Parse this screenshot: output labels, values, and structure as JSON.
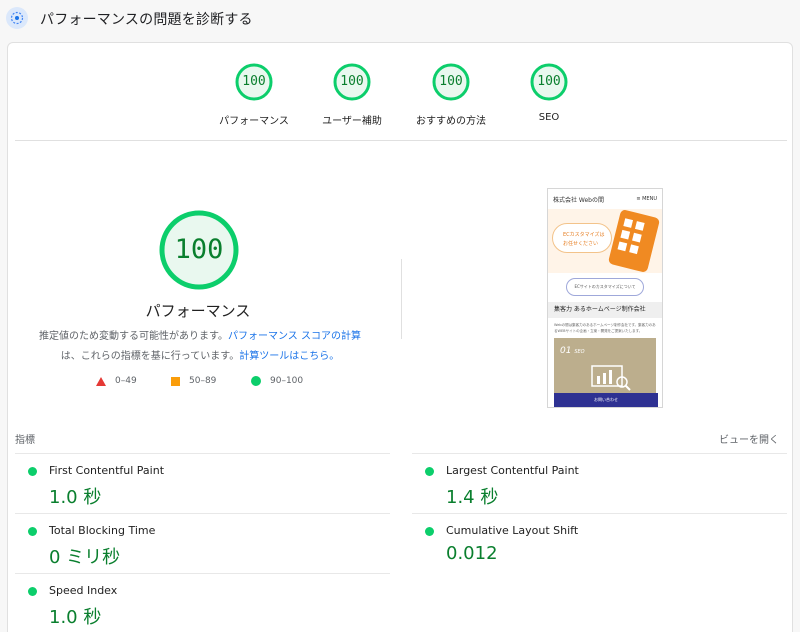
{
  "header": {
    "title": "パフォーマンスの問題を診断する",
    "icon": "lighthouse-icon"
  },
  "colors": {
    "good": "#0cce6b",
    "good_text": "#0a7f2e",
    "average": "#fa9d0a",
    "poor": "#e53935",
    "link": "#1a73e8"
  },
  "gauges": [
    {
      "score": "100",
      "label": "パフォーマンス",
      "fraction": 1.0
    },
    {
      "score": "100",
      "label": "ユーザー補助",
      "fraction": 1.0
    },
    {
      "score": "100",
      "label": "おすすめの方法",
      "fraction": 1.0
    },
    {
      "score": "100",
      "label": "SEO",
      "fraction": 1.0
    }
  ],
  "performance": {
    "score": "100",
    "label": "パフォーマンス",
    "desc_part1": "推定値のため変動する可能性があります。",
    "desc_link1": "パフォーマンス スコアの計算",
    "desc_part2": "は、これらの指標を基に行っています。",
    "desc_link2": "計算ツールはこちら。"
  },
  "legend": {
    "poor": "0–49",
    "average": "50–89",
    "good": "90–100"
  },
  "preview": {
    "brand": "株式会社 Webの間",
    "menu": "≡ MENU",
    "hero_line1": "ECカスタマイズは",
    "hero_line2": "お任せください",
    "button": "ECサイトのカスタマイズについて",
    "section_title": "集客力 あるホームページ制作会社",
    "body_text": "Webの間は集客力のあるホームページ制作会社です。集客力のあるWEBサイトの企画・立案・開発をご提案いたします。",
    "image_label": "01",
    "image_sub": "SEO",
    "footer": "お問い合わせ"
  },
  "metrics": {
    "label": "指標",
    "view_toggle": "ビューを開く",
    "items": [
      {
        "name": "First Contentful Paint",
        "value": "1.0 秒"
      },
      {
        "name": "Largest Contentful Paint",
        "value": "1.4 秒"
      },
      {
        "name": "Total Blocking Time",
        "value": "0 ミリ秒"
      },
      {
        "name": "Cumulative Layout Shift",
        "value": "0.012"
      },
      {
        "name": "Speed Index",
        "value": "1.0 秒"
      }
    ]
  }
}
